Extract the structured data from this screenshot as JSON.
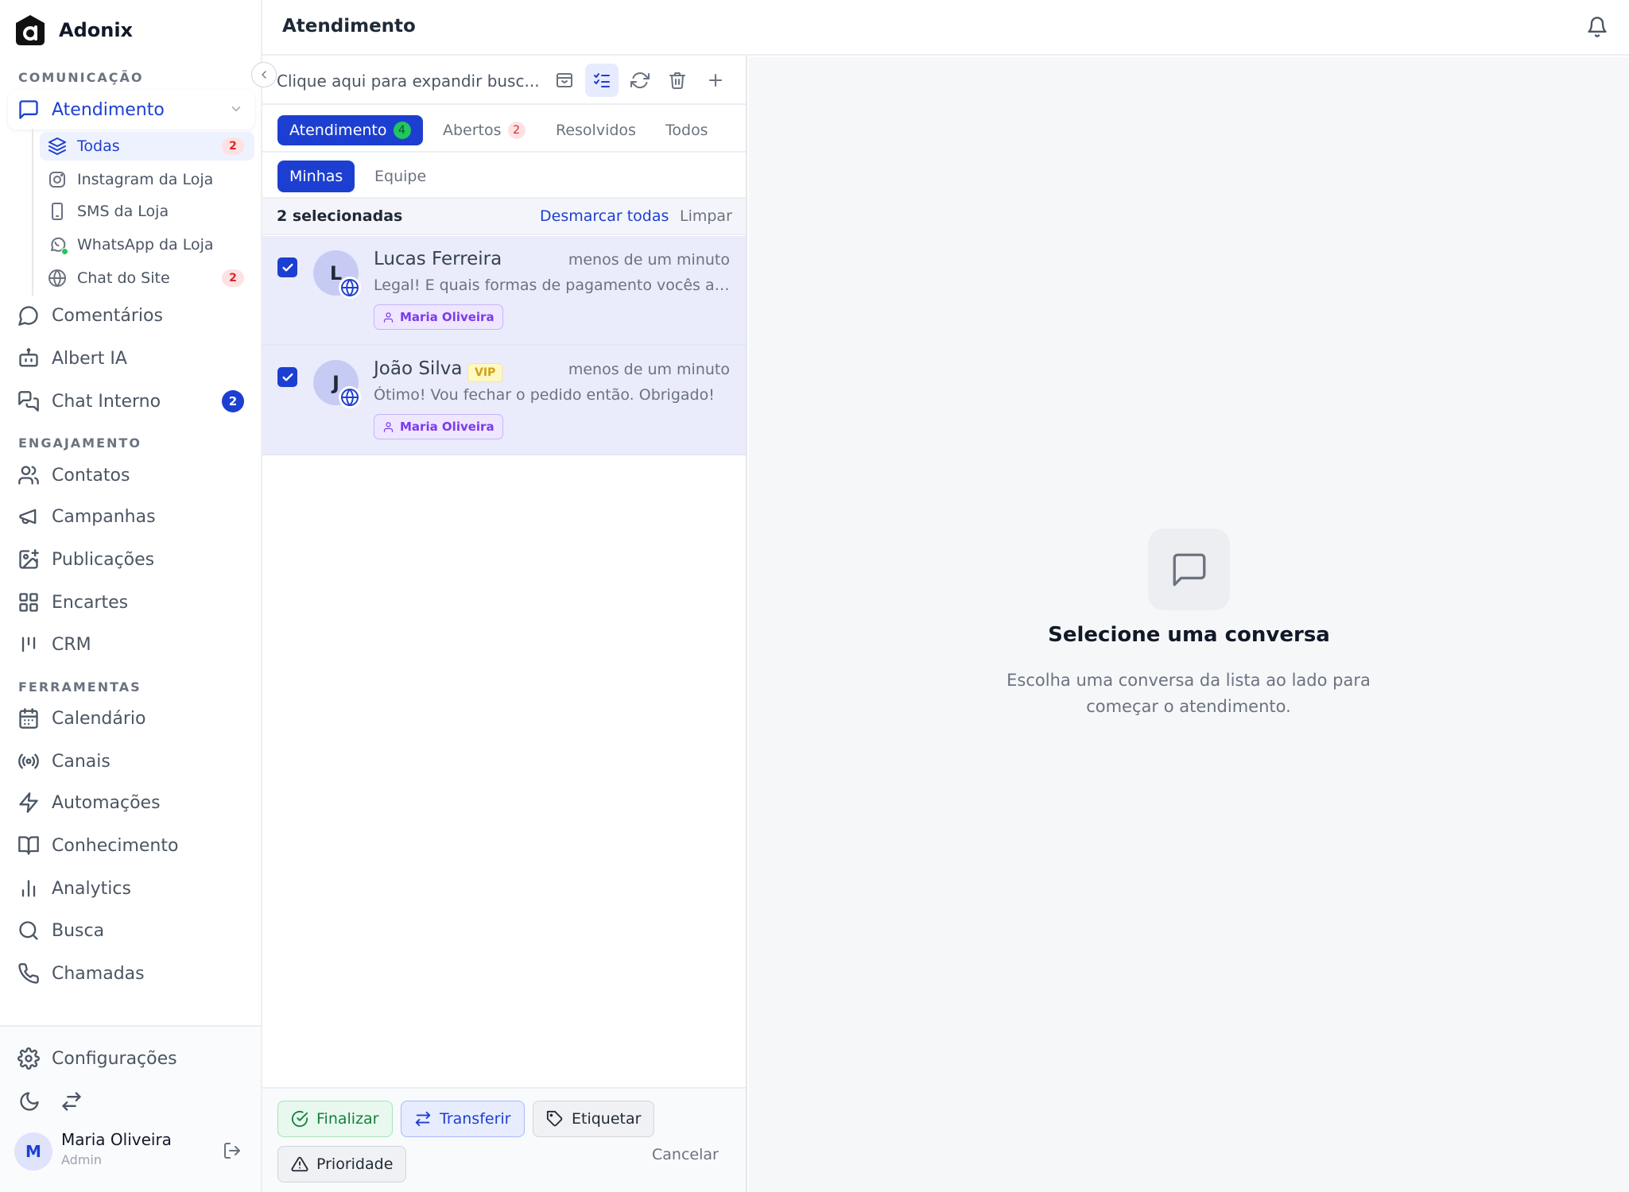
{
  "app": {
    "name": "Adonix"
  },
  "header": {
    "title": "Atendimento"
  },
  "sidebar": {
    "sections": {
      "communication": "COMUNICAÇÃO",
      "engagement": "ENGAJAMENTO",
      "tools": "FERRAMENTAS"
    },
    "atendimento": {
      "label": "Atendimento"
    },
    "subitems": [
      {
        "label": "Todas",
        "badge": "2",
        "icon": "layers-icon"
      },
      {
        "label": "Instagram da Loja",
        "icon": "instagram-icon"
      },
      {
        "label": "SMS da Loja",
        "icon": "smartphone-icon"
      },
      {
        "label": "WhatsApp da Loja",
        "icon": "whatsapp-icon"
      },
      {
        "label": "Chat do Site",
        "badge": "2",
        "icon": "globe-icon"
      }
    ],
    "comm_items": [
      {
        "label": "Comentários",
        "icon": "comment-icon"
      },
      {
        "label": "Albert IA",
        "icon": "bot-icon"
      },
      {
        "label": "Chat Interno",
        "badge": "2",
        "icon": "chats-icon"
      }
    ],
    "engagement_items": [
      {
        "label": "Contatos",
        "icon": "users-icon"
      },
      {
        "label": "Campanhas",
        "icon": "megaphone-icon"
      },
      {
        "label": "Publicações",
        "icon": "image-plus-icon"
      },
      {
        "label": "Encartes",
        "icon": "grid-icon"
      },
      {
        "label": "CRM",
        "icon": "kanban-icon"
      }
    ],
    "tools_items": [
      {
        "label": "Calendário",
        "icon": "calendar-icon"
      },
      {
        "label": "Canais",
        "icon": "radio-icon"
      },
      {
        "label": "Automações",
        "icon": "zap-icon"
      },
      {
        "label": "Conhecimento",
        "icon": "book-icon"
      },
      {
        "label": "Analytics",
        "icon": "bar-chart-icon"
      },
      {
        "label": "Busca",
        "icon": "search-icon"
      },
      {
        "label": "Chamadas",
        "icon": "phone-icon"
      }
    ],
    "settings": {
      "label": "Configurações"
    },
    "user": {
      "initial": "M",
      "name": "Maria Oliveira",
      "role": "Admin"
    }
  },
  "list": {
    "search_placeholder": "Clique aqui para expandir busc...",
    "tabs": [
      {
        "label": "Atendimento",
        "count": "4"
      },
      {
        "label": "Abertos",
        "count": "2"
      },
      {
        "label": "Resolvidos"
      },
      {
        "label": "Todos"
      }
    ],
    "subtabs": [
      {
        "label": "Minhas"
      },
      {
        "label": "Equipe"
      }
    ],
    "selection": {
      "count_text": "2 selecionadas",
      "deselect_all": "Desmarcar todas",
      "clear": "Limpar"
    },
    "conversations": [
      {
        "initial": "L",
        "name": "Lucas Ferreira",
        "time": "menos de um minuto",
        "preview": "Legal! E quais formas de pagamento vocês aceitam?",
        "agent": "Maria Oliveira",
        "checked": true
      },
      {
        "initial": "J",
        "name": "João Silva",
        "vip": "VIP",
        "time": "menos de um minuto",
        "preview": "Ótimo! Vou fechar o pedido então. Obrigado!",
        "agent": "Maria Oliveira",
        "checked": true
      }
    ],
    "actions": {
      "finalize": "Finalizar",
      "transfer": "Transferir",
      "tag": "Etiquetar",
      "priority": "Prioridade",
      "cancel": "Cancelar"
    }
  },
  "empty_state": {
    "title": "Selecione uma conversa",
    "description": "Escolha uma conversa da lista ao lado para começar o atendimento."
  },
  "colors": {
    "accent": "#1d3fd1",
    "selected_row": "#eaecfb",
    "badge_pink": "#fde2e4",
    "success": "#22c55e"
  }
}
